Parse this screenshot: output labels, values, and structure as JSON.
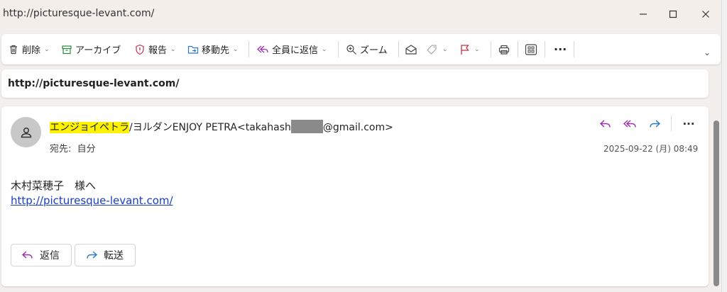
{
  "window": {
    "title_url": "http://picturesque-levant.com/",
    "minimize_glyph": "—",
    "maximize_glyph": "☐",
    "close_glyph": "✕"
  },
  "toolbar": {
    "delete_label": "削除",
    "archive_label": "アーカイブ",
    "report_label": "報告",
    "move_label": "移動先",
    "reply_all_label": "全員に返信",
    "zoom_label": "ズーム",
    "more_glyph": "···",
    "chevron": "⌄",
    "expand_glyph": "⌄"
  },
  "subject": {
    "text": "http://picturesque-levant.com/"
  },
  "message": {
    "sender_highlight": "エンジョイペトラ",
    "sender_rest": "/ヨルダンENJOY PETRA<takahash",
    "sender_email_suffix": "@gmail.com>",
    "to_label": "宛先:",
    "to_value": "自分",
    "date": "2025-09-22 (月) 08:49",
    "more_glyph": "···",
    "body_line1": "木村菜穂子　様へ",
    "body_link": "http://picturesque-levant.com/",
    "reply_button": "返信",
    "forward_button": "転送"
  },
  "colors": {
    "accent_purple": "#9b2fae",
    "accent_blue": "#2f78c4",
    "highlight": "#fff200",
    "link": "#1a3dc2"
  }
}
